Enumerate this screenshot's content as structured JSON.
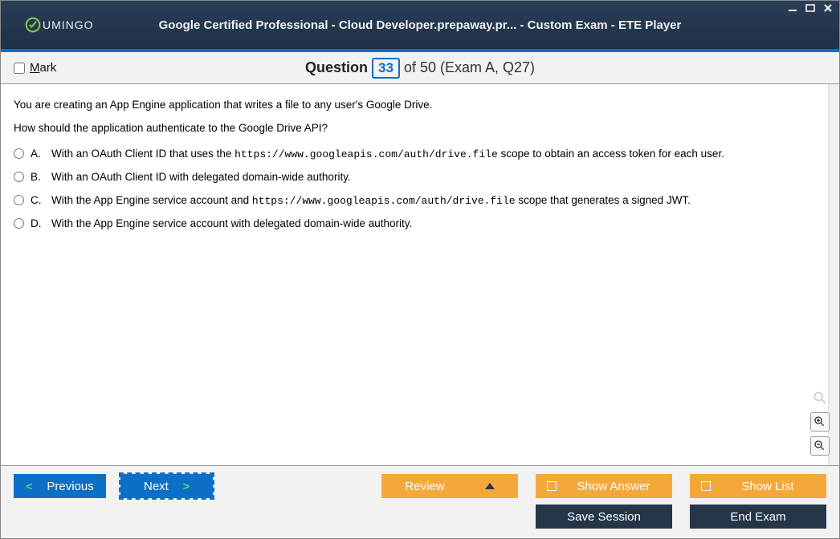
{
  "logo": {
    "text": "UMINGO"
  },
  "title": "Google Certified Professional - Cloud Developer.prepaway.pr... - Custom Exam - ETE Player",
  "win": {
    "min": "_",
    "max": "□",
    "close": "✕"
  },
  "header": {
    "mark_label": "Mark",
    "question_word": "Question",
    "number": "33",
    "of_text": "of 50 (Exam A, Q27)"
  },
  "question": {
    "line1": "You are creating an App Engine application that writes a file to any user's Google Drive.",
    "line2": "How should the application authenticate to the Google Drive API?",
    "options": [
      {
        "letter": "A.",
        "pre": "With an OAuth Client ID that uses the ",
        "code": "https://www.googleapis.com/auth/drive.file",
        "post": " scope to obtain an access token for each user."
      },
      {
        "letter": "B.",
        "pre": "With an OAuth Client ID with delegated domain-wide authority.",
        "code": "",
        "post": ""
      },
      {
        "letter": "C.",
        "pre": "With the App Engine service account and ",
        "code": "https://www.googleapis.com/auth/drive.file",
        "post": " scope that generates a signed JWT."
      },
      {
        "letter": "D.",
        "pre": "With the App Engine service account with delegated domain-wide authority.",
        "code": "",
        "post": ""
      }
    ]
  },
  "footer": {
    "previous": "Previous",
    "next": "Next",
    "review": "Review",
    "show_answer": "Show Answer",
    "show_list": "Show List",
    "save_session": "Save Session",
    "end_exam": "End Exam"
  }
}
